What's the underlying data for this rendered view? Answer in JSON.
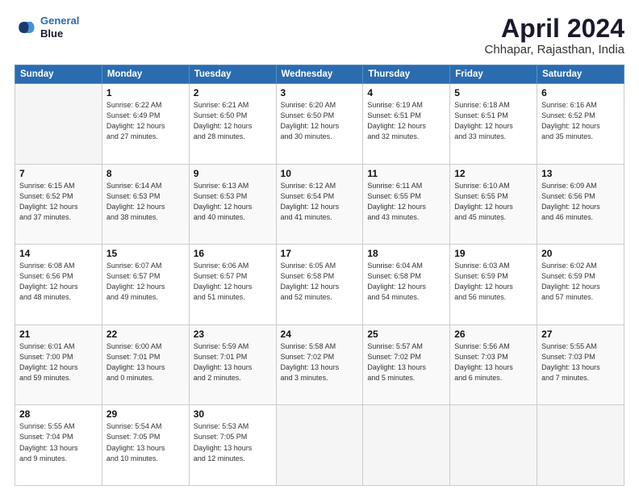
{
  "header": {
    "logo_line1": "General",
    "logo_line2": "Blue",
    "main_title": "April 2024",
    "subtitle": "Chhapar, Rajasthan, India"
  },
  "columns": [
    "Sunday",
    "Monday",
    "Tuesday",
    "Wednesday",
    "Thursday",
    "Friday",
    "Saturday"
  ],
  "weeks": [
    [
      {
        "day": "",
        "info": ""
      },
      {
        "day": "1",
        "info": "Sunrise: 6:22 AM\nSunset: 6:49 PM\nDaylight: 12 hours\nand 27 minutes."
      },
      {
        "day": "2",
        "info": "Sunrise: 6:21 AM\nSunset: 6:50 PM\nDaylight: 12 hours\nand 28 minutes."
      },
      {
        "day": "3",
        "info": "Sunrise: 6:20 AM\nSunset: 6:50 PM\nDaylight: 12 hours\nand 30 minutes."
      },
      {
        "day": "4",
        "info": "Sunrise: 6:19 AM\nSunset: 6:51 PM\nDaylight: 12 hours\nand 32 minutes."
      },
      {
        "day": "5",
        "info": "Sunrise: 6:18 AM\nSunset: 6:51 PM\nDaylight: 12 hours\nand 33 minutes."
      },
      {
        "day": "6",
        "info": "Sunrise: 6:16 AM\nSunset: 6:52 PM\nDaylight: 12 hours\nand 35 minutes."
      }
    ],
    [
      {
        "day": "7",
        "info": "Sunrise: 6:15 AM\nSunset: 6:52 PM\nDaylight: 12 hours\nand 37 minutes."
      },
      {
        "day": "8",
        "info": "Sunrise: 6:14 AM\nSunset: 6:53 PM\nDaylight: 12 hours\nand 38 minutes."
      },
      {
        "day": "9",
        "info": "Sunrise: 6:13 AM\nSunset: 6:53 PM\nDaylight: 12 hours\nand 40 minutes."
      },
      {
        "day": "10",
        "info": "Sunrise: 6:12 AM\nSunset: 6:54 PM\nDaylight: 12 hours\nand 41 minutes."
      },
      {
        "day": "11",
        "info": "Sunrise: 6:11 AM\nSunset: 6:55 PM\nDaylight: 12 hours\nand 43 minutes."
      },
      {
        "day": "12",
        "info": "Sunrise: 6:10 AM\nSunset: 6:55 PM\nDaylight: 12 hours\nand 45 minutes."
      },
      {
        "day": "13",
        "info": "Sunrise: 6:09 AM\nSunset: 6:56 PM\nDaylight: 12 hours\nand 46 minutes."
      }
    ],
    [
      {
        "day": "14",
        "info": "Sunrise: 6:08 AM\nSunset: 6:56 PM\nDaylight: 12 hours\nand 48 minutes."
      },
      {
        "day": "15",
        "info": "Sunrise: 6:07 AM\nSunset: 6:57 PM\nDaylight: 12 hours\nand 49 minutes."
      },
      {
        "day": "16",
        "info": "Sunrise: 6:06 AM\nSunset: 6:57 PM\nDaylight: 12 hours\nand 51 minutes."
      },
      {
        "day": "17",
        "info": "Sunrise: 6:05 AM\nSunset: 6:58 PM\nDaylight: 12 hours\nand 52 minutes."
      },
      {
        "day": "18",
        "info": "Sunrise: 6:04 AM\nSunset: 6:58 PM\nDaylight: 12 hours\nand 54 minutes."
      },
      {
        "day": "19",
        "info": "Sunrise: 6:03 AM\nSunset: 6:59 PM\nDaylight: 12 hours\nand 56 minutes."
      },
      {
        "day": "20",
        "info": "Sunrise: 6:02 AM\nSunset: 6:59 PM\nDaylight: 12 hours\nand 57 minutes."
      }
    ],
    [
      {
        "day": "21",
        "info": "Sunrise: 6:01 AM\nSunset: 7:00 PM\nDaylight: 12 hours\nand 59 minutes."
      },
      {
        "day": "22",
        "info": "Sunrise: 6:00 AM\nSunset: 7:01 PM\nDaylight: 13 hours\nand 0 minutes."
      },
      {
        "day": "23",
        "info": "Sunrise: 5:59 AM\nSunset: 7:01 PM\nDaylight: 13 hours\nand 2 minutes."
      },
      {
        "day": "24",
        "info": "Sunrise: 5:58 AM\nSunset: 7:02 PM\nDaylight: 13 hours\nand 3 minutes."
      },
      {
        "day": "25",
        "info": "Sunrise: 5:57 AM\nSunset: 7:02 PM\nDaylight: 13 hours\nand 5 minutes."
      },
      {
        "day": "26",
        "info": "Sunrise: 5:56 AM\nSunset: 7:03 PM\nDaylight: 13 hours\nand 6 minutes."
      },
      {
        "day": "27",
        "info": "Sunrise: 5:55 AM\nSunset: 7:03 PM\nDaylight: 13 hours\nand 7 minutes."
      }
    ],
    [
      {
        "day": "28",
        "info": "Sunrise: 5:55 AM\nSunset: 7:04 PM\nDaylight: 13 hours\nand 9 minutes."
      },
      {
        "day": "29",
        "info": "Sunrise: 5:54 AM\nSunset: 7:05 PM\nDaylight: 13 hours\nand 10 minutes."
      },
      {
        "day": "30",
        "info": "Sunrise: 5:53 AM\nSunset: 7:05 PM\nDaylight: 13 hours\nand 12 minutes."
      },
      {
        "day": "",
        "info": ""
      },
      {
        "day": "",
        "info": ""
      },
      {
        "day": "",
        "info": ""
      },
      {
        "day": "",
        "info": ""
      }
    ]
  ]
}
